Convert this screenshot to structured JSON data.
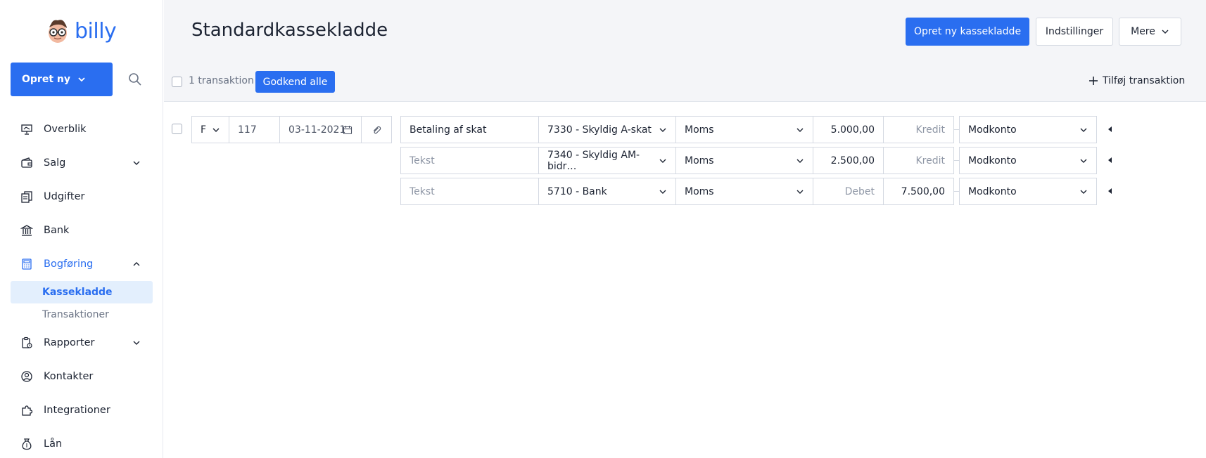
{
  "app": {
    "logo_text": "billy",
    "brand_color": "#2a6ef0"
  },
  "sidebar": {
    "create_label": "Opret ny",
    "items": [
      {
        "label": "Overblik",
        "icon": "presentation-icon"
      },
      {
        "label": "Salg",
        "icon": "wallet-icon"
      },
      {
        "label": "Udgifter",
        "icon": "receipt-icon"
      },
      {
        "label": "Bank",
        "icon": "bank-icon"
      },
      {
        "label": "Bogføring",
        "icon": "calculator-icon"
      },
      {
        "label": "Rapporter",
        "icon": "report-icon"
      },
      {
        "label": "Kontakter",
        "icon": "user-circle-icon"
      },
      {
        "label": "Integrationer",
        "icon": "puzzle-icon"
      },
      {
        "label": "Lån",
        "icon": "money-bag-icon"
      }
    ],
    "sub_items": [
      {
        "label": "Kassekladde"
      },
      {
        "label": "Transaktioner"
      }
    ]
  },
  "header": {
    "title": "Standardkassekladde",
    "primary_button": "Opret ny kassekladde",
    "settings_button": "Indstillinger",
    "more_button": "Mere"
  },
  "toolbar": {
    "count_label": "1 transaktion",
    "approve_all": "Godkend alle",
    "add_transaction": "Tilføj transaktion"
  },
  "transaction": {
    "type": "F",
    "number": "117",
    "date": "03-11-2021",
    "lines": [
      {
        "text": "Betaling af skat",
        "text_placeholder": false,
        "account": "7330 - Skyldig A-skat",
        "vat": "Moms",
        "debit": "5.000,00",
        "debit_placeholder": false,
        "credit": "Kredit",
        "credit_placeholder": true,
        "contra": "Modkonto"
      },
      {
        "text": "Tekst",
        "text_placeholder": true,
        "account": "7340 - Skyldig AM-bidr…",
        "vat": "Moms",
        "debit": "2.500,00",
        "debit_placeholder": false,
        "credit": "Kredit",
        "credit_placeholder": true,
        "contra": "Modkonto"
      },
      {
        "text": "Tekst",
        "text_placeholder": true,
        "account": "5710 - Bank",
        "vat": "Moms",
        "debit": "Debet",
        "debit_placeholder": true,
        "credit": "7.500,00",
        "credit_placeholder": false,
        "contra": "Modkonto"
      }
    ]
  }
}
